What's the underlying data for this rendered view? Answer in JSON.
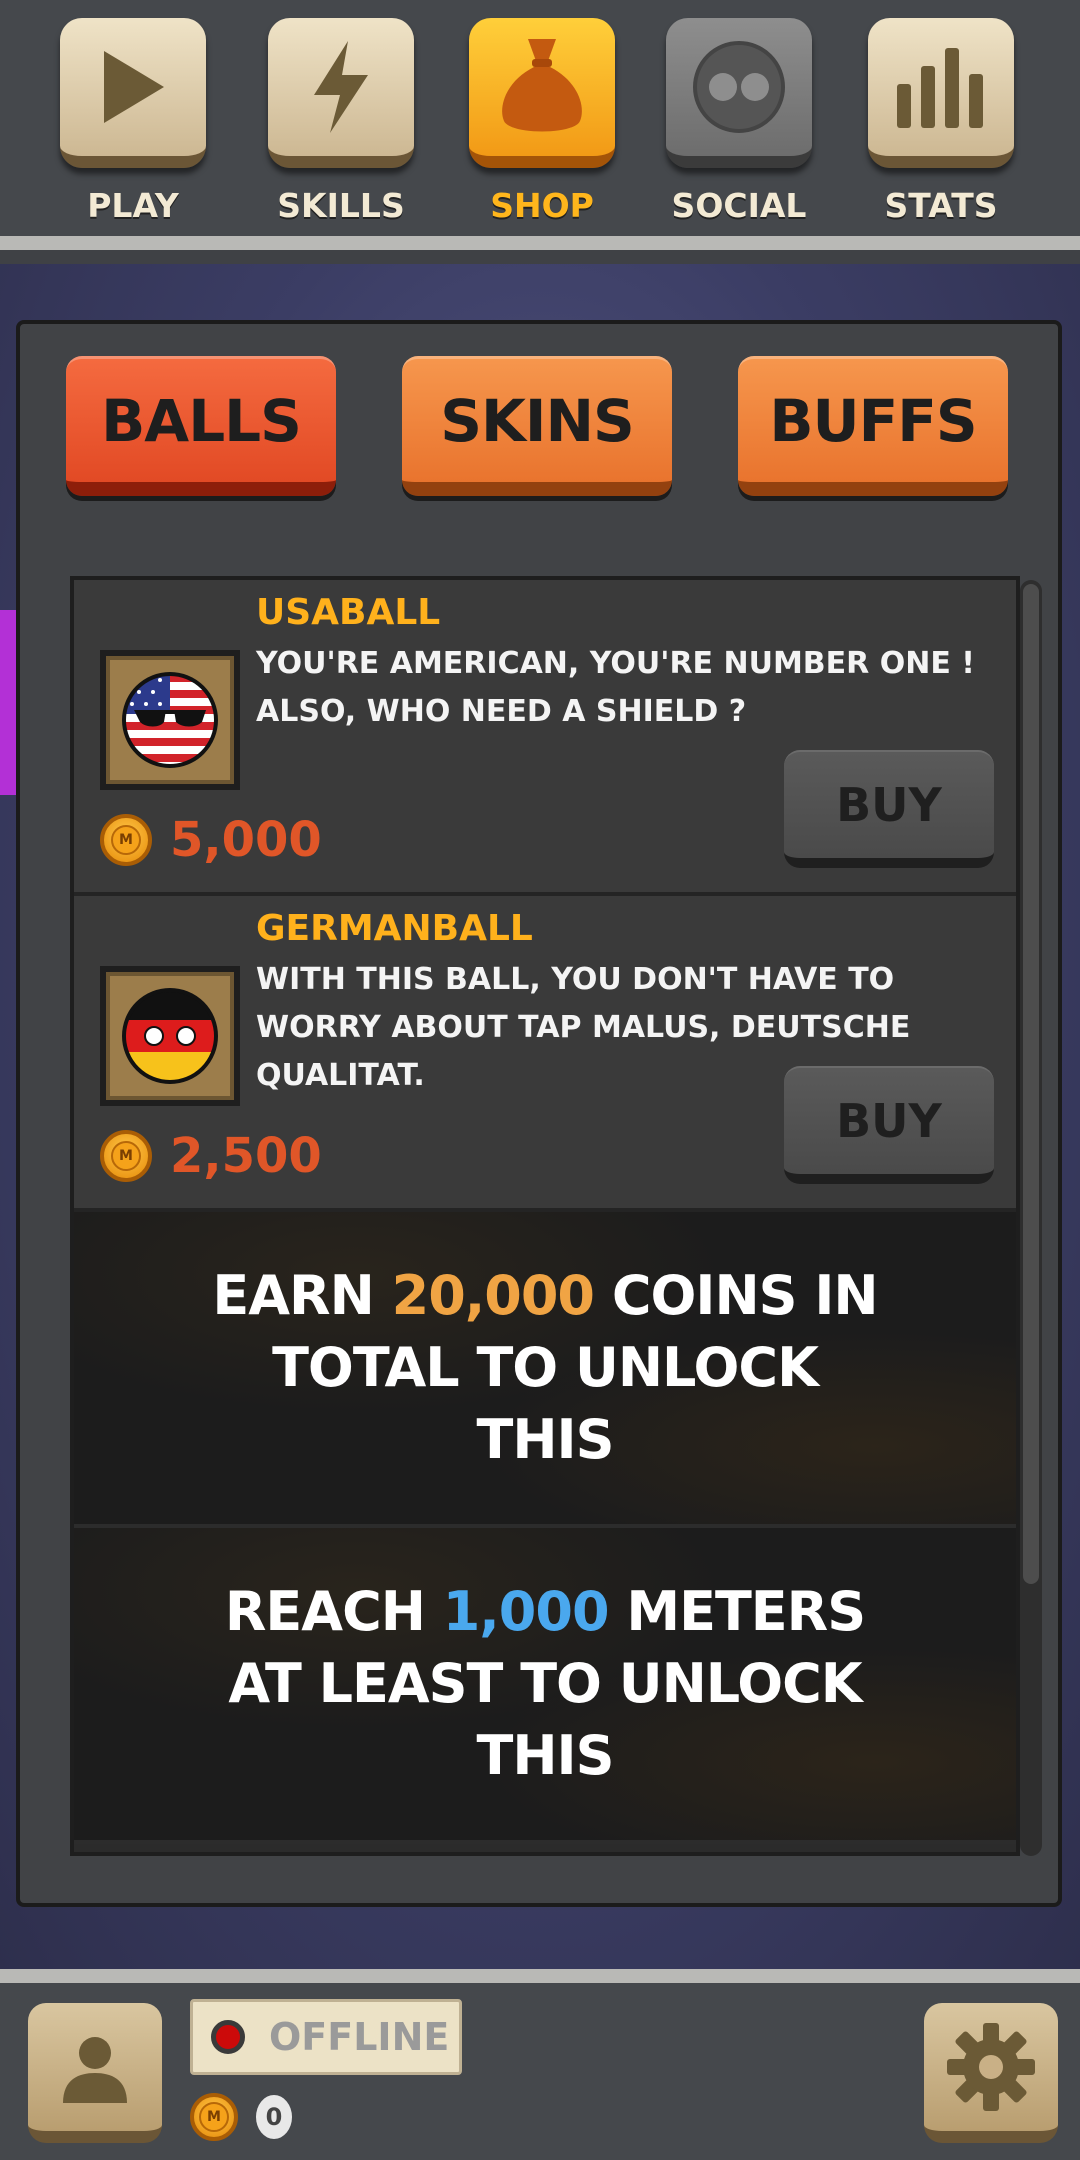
{
  "nav": {
    "items": [
      {
        "label": "PLAY",
        "icon": "play-icon"
      },
      {
        "label": "SKILLS",
        "icon": "lightning-icon"
      },
      {
        "label": "SHOP",
        "icon": "money-bag-icon",
        "active": true
      },
      {
        "label": "SOCIAL",
        "icon": "social-icon"
      },
      {
        "label": "STATS",
        "icon": "bar-chart-icon"
      }
    ]
  },
  "tabs": [
    {
      "label": "BALLS",
      "active": true
    },
    {
      "label": "SKINS"
    },
    {
      "label": "BUFFS"
    }
  ],
  "items": [
    {
      "name": "USABALL",
      "description": "YOU'RE AMERICAN, YOU'RE NUMBER ONE ! ALSO, WHO NEED  A SHIELD ?",
      "price": "5,000",
      "buy_label": "BUY",
      "icon": "usa-ball-icon"
    },
    {
      "name": "GERMANBALL",
      "description": "WITH THIS BALL, YOU DON'T HAVE TO WORRY ABOUT TAP MALUS, DEUTSCHE QUALITAT.",
      "price": "2,500",
      "buy_label": "BUY",
      "icon": "germany-ball-icon"
    }
  ],
  "locked": [
    {
      "pre": "EARN ",
      "highlight": "20,000",
      "post": " COINS IN TOTAL TO UNLOCK THIS"
    },
    {
      "pre": "REACH ",
      "highlight": "1,000",
      "post": " METERS AT LEAST TO UNLOCK THIS"
    }
  ],
  "bottom": {
    "status": "OFFLINE",
    "coins": "0"
  },
  "colors": {
    "accent": "#ffb11c",
    "price": "#e05628",
    "tab_active": "#e24a25",
    "tab": "#e9742e"
  }
}
